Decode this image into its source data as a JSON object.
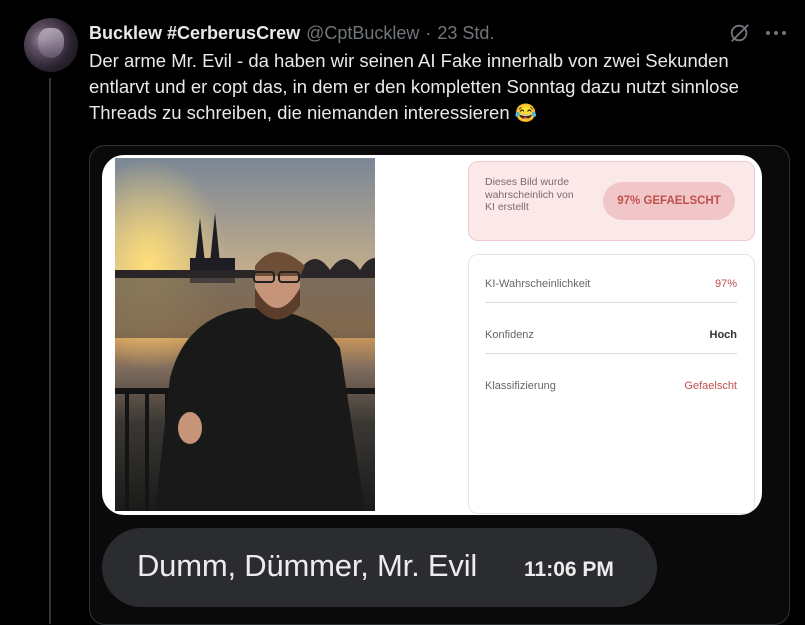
{
  "tweet": {
    "author_name": "Bucklew #CerberusCrew",
    "handle": "@CptBucklew",
    "separator": "·",
    "time": "23 Std.",
    "text": "Der arme Mr. Evil - da haben wir seinen AI Fake innerhalb von zwei Sekunden entlarvt und er copt das, in dem er den kompletten Sonntag dazu nutzt sinnlose Threads zu schreiben, die niemanden interessieren",
    "emoji": "😂"
  },
  "icons": {
    "grok": "grok-slash-icon",
    "more": "more-horizontal-icon"
  },
  "media": {
    "ai_check": {
      "notice": "Dieses Bild wurde wahrscheinlich von KI erstellt",
      "badge": "97% GEFAELSCHT",
      "rows": [
        {
          "label": "KI-Wahrscheinlichkeit",
          "value": "97%"
        },
        {
          "label": "Konfidenz",
          "value": "Hoch"
        },
        {
          "label": "Klassifizierung",
          "value": "Gefaelscht"
        }
      ]
    },
    "chat": {
      "message": "Dumm, Dümmer, Mr. Evil",
      "time": "11:06 PM"
    }
  },
  "colors": {
    "background": "#000000",
    "text_primary": "#e7e9ea",
    "text_secondary": "#71767b",
    "fake_red": "#c0504d",
    "badge_bg": "#f1c6c8",
    "bubble_bg": "#2b2c30"
  }
}
